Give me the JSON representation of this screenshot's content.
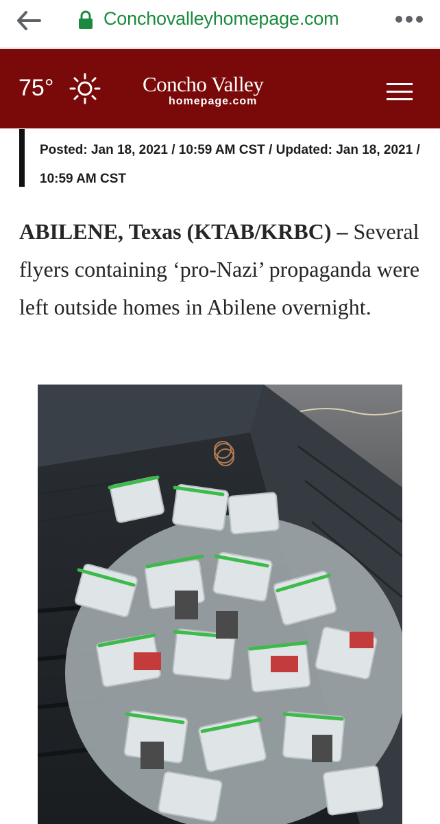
{
  "browser": {
    "url": "Conchovalleyhomepage.com"
  },
  "header": {
    "temperature": "75°",
    "weather_icon": "sun-icon",
    "logo_main": "Concho Valley",
    "logo_sub": "homepage.com",
    "accent_color": "#7a0a0a"
  },
  "article": {
    "posted": "Posted: Jan 18, 2021 / 10:59 AM CST / Updated: Jan 18, 2021 / 10:59 AM CST",
    "dateline": "ABILENE, Texas (KTAB/KRBC) –",
    "body": "Several flyers containing ‘pro-Nazi’ propaganda were left outside homes in Abilene overnight."
  }
}
